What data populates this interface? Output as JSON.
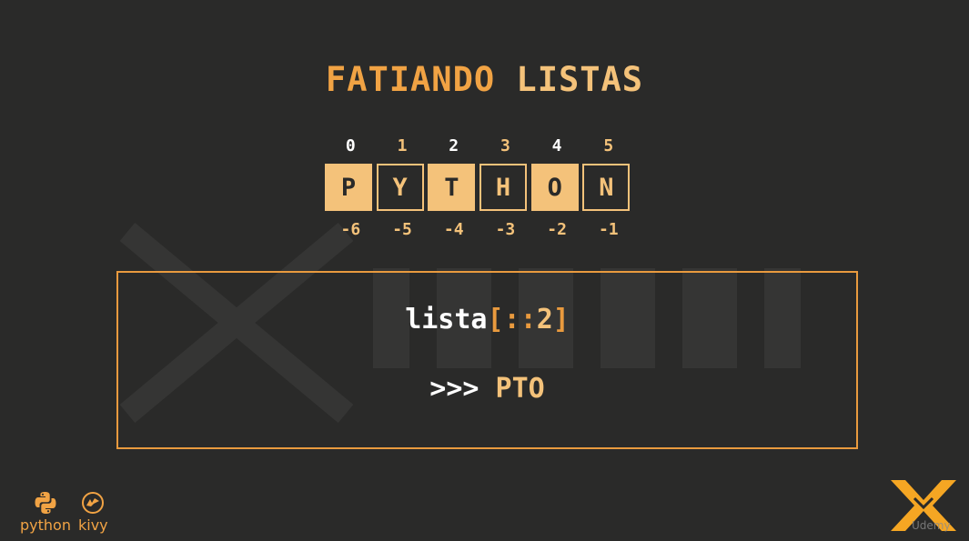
{
  "title": {
    "word1": "FATIANDO",
    "word2": "LISTAS"
  },
  "positive_indexes": [
    "0",
    "1",
    "2",
    "3",
    "4",
    "5"
  ],
  "letters": [
    {
      "char": "P",
      "style": "filled"
    },
    {
      "char": "Y",
      "style": "outlined"
    },
    {
      "char": "T",
      "style": "filled"
    },
    {
      "char": "H",
      "style": "outlined"
    },
    {
      "char": "O",
      "style": "filled"
    },
    {
      "char": "N",
      "style": "outlined"
    }
  ],
  "negative_indexes": [
    "-6",
    "-5",
    "-4",
    "-3",
    "-2",
    "-1"
  ],
  "code": {
    "name": "lista",
    "open_bracket": "[",
    "colons": "::",
    "step": "2",
    "close_bracket": "]"
  },
  "result": {
    "prompt": ">>>",
    "output": "PTO"
  },
  "logos": {
    "python_label": "python",
    "kivy_label": "kivy"
  },
  "brand_mark": "Udemy",
  "colors": {
    "background": "#2a2a29",
    "accent_orange": "#e99a3e",
    "accent_light": "#f4c27a",
    "text_white": "#ffffff"
  }
}
